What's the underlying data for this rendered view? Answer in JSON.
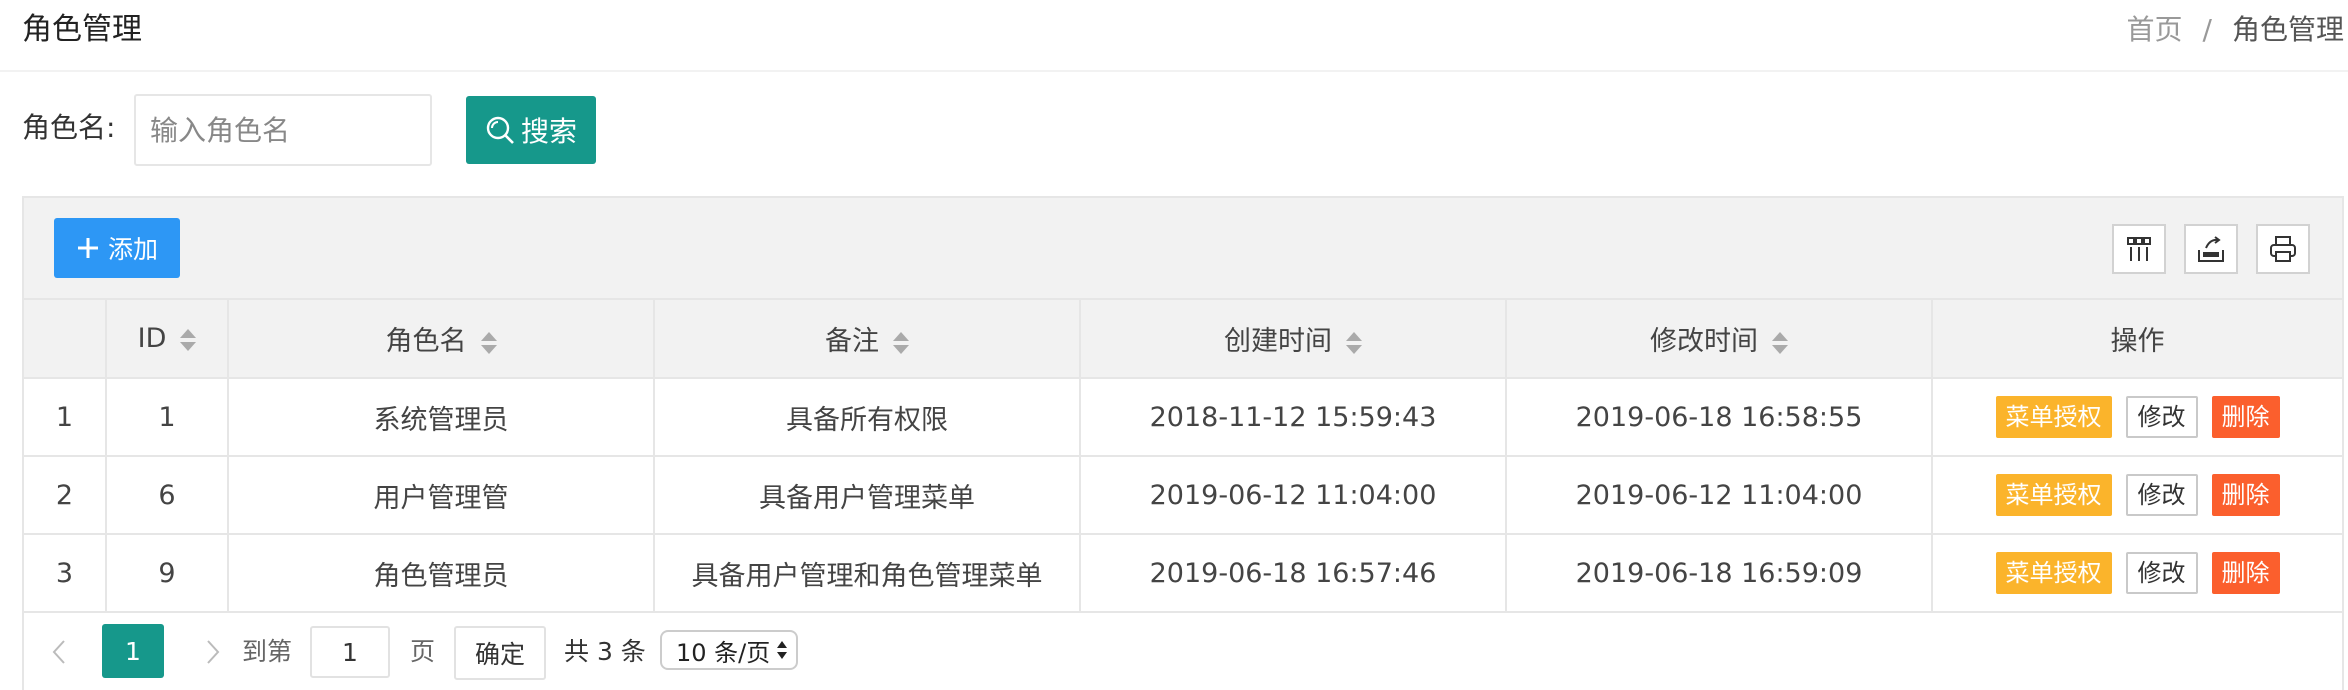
{
  "header": {
    "title": "角色管理",
    "breadcrumb": {
      "home": "首页",
      "separator": "/",
      "current": "角色管理"
    }
  },
  "search": {
    "label": "角色名:",
    "placeholder": "输入角色名",
    "value": "",
    "button_label": "搜索"
  },
  "toolbar": {
    "add_label": "添加",
    "icons": [
      "columns-icon",
      "export-icon",
      "print-icon"
    ]
  },
  "table": {
    "columns": [
      "",
      "ID",
      "角色名",
      "备注",
      "创建时间",
      "修改时间",
      "操作"
    ],
    "rows": [
      {
        "index": "1",
        "id": "1",
        "name": "系统管理员",
        "remark": "具备所有权限",
        "created": "2018-11-12 15:59:43",
        "modified": "2019-06-18 16:58:55"
      },
      {
        "index": "2",
        "id": "6",
        "name": "用户管理管",
        "remark": "具备用户管理菜单",
        "created": "2019-06-12 11:04:00",
        "modified": "2019-06-12 11:04:00"
      },
      {
        "index": "3",
        "id": "9",
        "name": "角色管理员",
        "remark": "具备用户管理和角色管理菜单",
        "created": "2019-06-18 16:57:46",
        "modified": "2019-06-18 16:59:09"
      }
    ],
    "actions": {
      "grant": "菜单授权",
      "edit": "修改",
      "delete": "删除"
    }
  },
  "pager": {
    "current_page": "1",
    "goto_label": "到第",
    "goto_value": "1",
    "page_label": "页",
    "confirm_label": "确定",
    "total_label": "共 3 条",
    "page_size": "10 条/页"
  },
  "colors": {
    "primary_teal": "#16988b",
    "add_blue": "#2d97f5",
    "warm_yellow": "#fbb42b",
    "danger_orange": "#fb5f2d"
  }
}
